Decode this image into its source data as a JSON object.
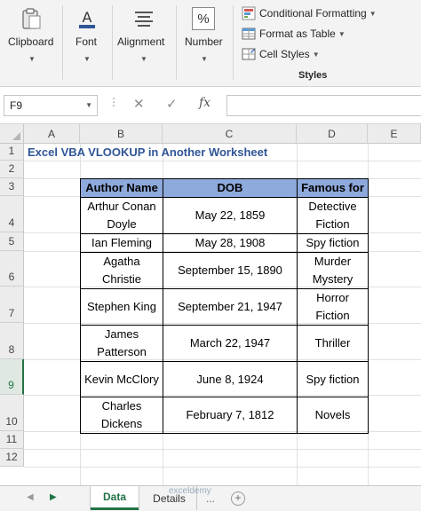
{
  "ribbon": {
    "groups": [
      {
        "key": "clipboard",
        "label": "Clipboard",
        "icon": "clipboard-icon"
      },
      {
        "key": "font",
        "label": "Font",
        "icon": "font-color-icon"
      },
      {
        "key": "alignment",
        "label": "Alignment",
        "icon": "align-icon"
      },
      {
        "key": "number",
        "label": "Number",
        "icon": "percent-icon"
      }
    ],
    "styles": {
      "items": [
        "Conditional Formatting",
        "Format as Table",
        "Cell Styles"
      ],
      "group_label": "Styles"
    },
    "number_glyph": "%"
  },
  "formula_bar": {
    "name_box": "F9",
    "dots": "⋮",
    "cancel": "✕",
    "enter": "✓",
    "fx": "fx",
    "value": ""
  },
  "grid": {
    "columns": [
      "A",
      "B",
      "C",
      "D",
      "E"
    ],
    "rows": [
      "1",
      "2",
      "3",
      "4",
      "5",
      "6",
      "7",
      "8",
      "9",
      "10",
      "11",
      "12"
    ],
    "selected_row": "9",
    "title": "Excel VBA VLOOKUP in Another Worksheet"
  },
  "table": {
    "headers": [
      "Author Name",
      "DOB",
      "Famous for"
    ],
    "rows": [
      {
        "author": "Arthur Conan Doyle",
        "dob": "May 22, 1859",
        "famous": "Detective Fiction"
      },
      {
        "author": "Ian Fleming",
        "dob": "May 28, 1908",
        "famous": "Spy fiction"
      },
      {
        "author": "Agatha Christie",
        "dob": "September 15, 1890",
        "famous": "Murder Mystery"
      },
      {
        "author": "Stephen King",
        "dob": "September 21, 1947",
        "famous": "Horror Fiction"
      },
      {
        "author": "James Patterson",
        "dob": "March 22, 1947",
        "famous": "Thriller"
      },
      {
        "author": "Kevin McClory",
        "dob": "June 8, 1924",
        "famous": "Spy fiction"
      },
      {
        "author": "Charles Dickens",
        "dob": "February 7, 1812",
        "famous": "Novels"
      }
    ]
  },
  "tabs": {
    "items": [
      "Data",
      "Details"
    ],
    "active": "Data",
    "more": "...",
    "add": "+",
    "prev": "◀",
    "next": "▶"
  },
  "watermark": "exceldemy",
  "colors": {
    "excel_green": "#217346",
    "header_fill": "#8ea9db",
    "title_blue": "#2f5597"
  }
}
